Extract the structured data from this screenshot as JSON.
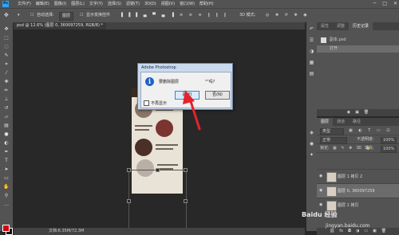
{
  "app": {
    "logo": "Ps"
  },
  "menus": [
    "文件(F)",
    "编辑(E)",
    "图像(I)",
    "图层(L)",
    "文字(Y)",
    "选择(S)",
    "滤镜(T)",
    "3D(D)",
    "视图(V)",
    "窗口(W)",
    "帮助(H)"
  ],
  "window_controls": [
    "─",
    "□",
    "✕"
  ],
  "options": {
    "move_icon": "move-icon",
    "auto_select_label": "自动选择:",
    "auto_select_value": "图层",
    "show_transform_label": "显示变换控件"
  },
  "document": {
    "tab_label": "psd @ 12.6% (图层 0, 360097259, RGB/8) *",
    "status_text": "文档:6.35M/72.3M"
  },
  "dialog": {
    "title": "Adobe Photoshop",
    "message": "要删除图层",
    "message_suffix": "\"\"吗?",
    "yes_label": "是(Y)",
    "no_label": "否(N)",
    "dont_show_label": "不再显示"
  },
  "history_panel": {
    "tabs": [
      "属性",
      "调整",
      "历史记录"
    ],
    "active_tab": "历史记录",
    "snapshot": "副本.psd",
    "items": [
      "打开"
    ]
  },
  "layers_panel": {
    "tabs": [
      "图层",
      "通道",
      "路径"
    ],
    "kind_label": "类型",
    "blend_mode": "正常",
    "opacity_label": "不透明度:",
    "opacity_value": "100%",
    "lock_label": "锁定:",
    "fill_label": "填充:",
    "fill_value": "100%",
    "layers": [
      {
        "name": "图层 1 拷贝 2",
        "selected": false
      },
      {
        "name": "图层 0, 360097259",
        "selected": true
      },
      {
        "name": "图层 1 拷贝",
        "selected": false
      }
    ]
  },
  "watermark": {
    "line1": "Baidu 经验",
    "line2": "jingyan.baidu.com"
  },
  "colors": {
    "foreground": "#d4000e",
    "background": "#111111",
    "accent": "#2fa3f8",
    "arrow": "#e3232c"
  }
}
